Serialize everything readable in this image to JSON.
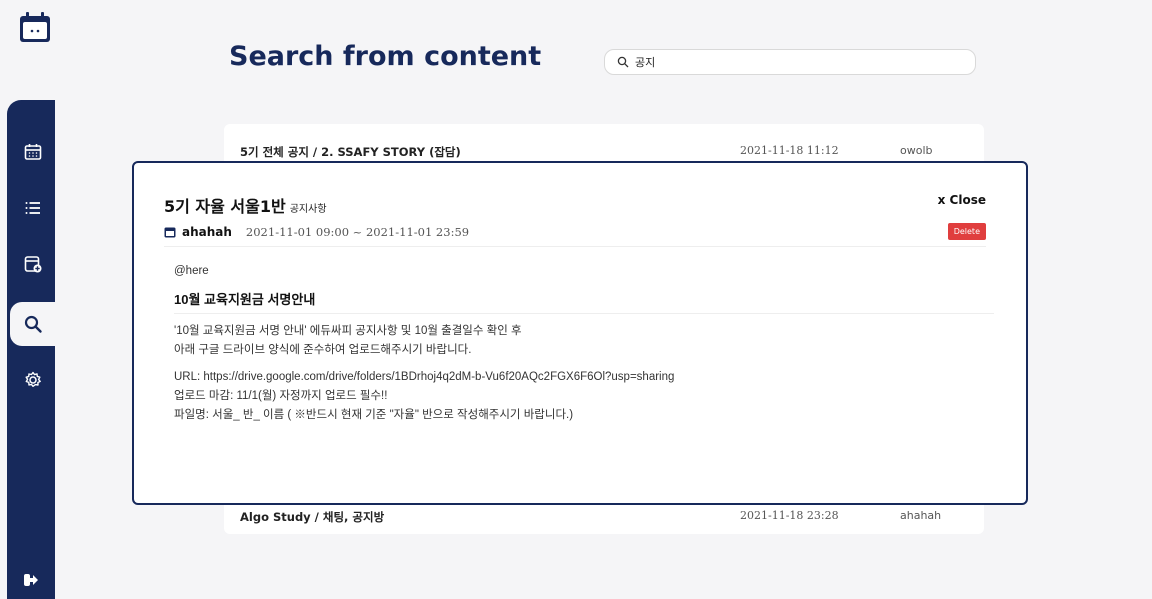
{
  "sidebar": {
    "items": [
      {
        "name": "calendar"
      },
      {
        "name": "list"
      },
      {
        "name": "add-calendar"
      },
      {
        "name": "search",
        "active": true
      },
      {
        "name": "settings"
      }
    ]
  },
  "header": {
    "title": "Search from content",
    "search_value": "공지"
  },
  "results": [
    {
      "title": "5기 전체 공지 / 2. SSAFY STORY (잡담)",
      "date": "2021-11-18 11:12",
      "user": "owolb"
    },
    {
      "title": "Algo Study / 채팅, 공지방",
      "date": "2021-11-18 23:28",
      "user": "ahahah"
    }
  ],
  "modal": {
    "title": "5기 자율 서울1반",
    "category": "공지사항",
    "close_label": "x Close",
    "author": "ahahah",
    "period": "2021-11-01 09:00 ~ 2021-11-01 23:59",
    "delete_label": "Delete",
    "mention": "@here",
    "heading": "10월 교육지원금 서명안내",
    "paragraph1": [
      "'10월 교육지원금 서명 안내' 에듀싸피 공지사항 및 10월 출결일수 확인 후",
      "아래 구글 드라이브 양식에 준수하여 업로드해주시기 바랍니다."
    ],
    "paragraph2": [
      "URL: https://drive.google.com/drive/folders/1BDrhoj4q2dM-b-Vu6f20AQc2FGX6F6Ol?usp=sharing",
      "업로드 마감: 11/1(월) 자정까지 업로드 필수!!",
      "파일명: 서울_ 반_ 이름 ( ※반드시 현재 기준 \"자율\" 반으로 작성해주시기 바랍니다.)"
    ]
  },
  "colors": {
    "brand": "#17295b",
    "delete": "#e03e3e",
    "background": "#f5f5f7"
  }
}
